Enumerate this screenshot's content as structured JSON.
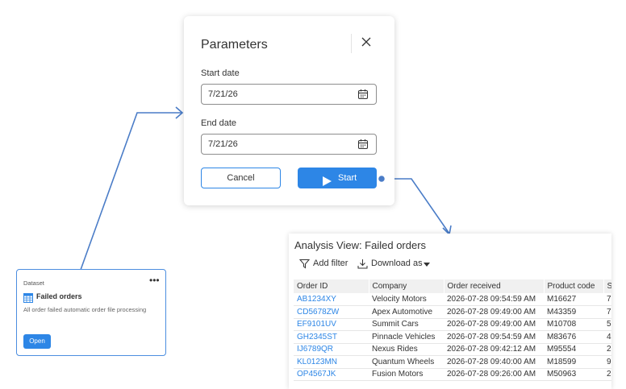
{
  "dialog": {
    "title": "Parameters",
    "start_label": "Start date",
    "start_value": "7/21/26",
    "end_label": "End date",
    "end_value": "7/21/26",
    "cancel_label": "Cancel",
    "start_button_label": "Start"
  },
  "card": {
    "type_label": "Dataset",
    "more_label": "•••",
    "title": "Failed orders",
    "description": "All order failed automatic order file processing",
    "open_label": "Open"
  },
  "analysis": {
    "title": "Analysis View: Failed orders",
    "add_filter_label": "Add filter",
    "download_label": "Download as",
    "columns": [
      "Order ID",
      "Company",
      "Order received",
      "Product code",
      "S"
    ],
    "rows": [
      [
        "AB1234XY",
        "Velocity Motors",
        "2026-07-28 09:54:59 AM",
        "M16627",
        "7"
      ],
      [
        "CD5678ZW",
        "Apex Automotive",
        "2026-07-28 09:49:00 AM",
        "M43359",
        "7"
      ],
      [
        "EF9101UV",
        "Summit Cars",
        "2026-07-28 09:49:00 AM",
        "M10708",
        "5"
      ],
      [
        "GH2345ST",
        "Pinnacle Vehicles",
        "2026-07-28 09:54:59 AM",
        "M83676",
        "4"
      ],
      [
        "IJ6789QR",
        "Nexus Rides",
        "2026-07-28 09:42:12 AM",
        "M95554",
        "2"
      ],
      [
        "KL0123MN",
        "Quantum Wheels",
        "2026-07-28 09:40:00 AM",
        "M18599",
        "9"
      ],
      [
        "OP4567JK",
        "Fusion Motors",
        "2026-07-28 09:26:00 AM",
        "M50963",
        "2"
      ]
    ]
  },
  "colors": {
    "accent": "#2d86e6",
    "connector": "#4a7cc7"
  }
}
